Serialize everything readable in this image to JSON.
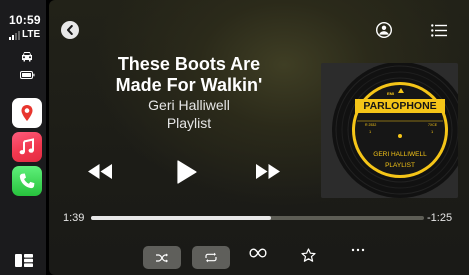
{
  "status_bar": {
    "time": "10:59",
    "network": "LTE"
  },
  "sidebar": {
    "apps": [
      {
        "name": "Maps",
        "icon": "maps-icon",
        "color": "#ffffff"
      },
      {
        "name": "Music",
        "icon": "music-note-icon",
        "color": "#f2384f"
      },
      {
        "name": "Phone",
        "icon": "phone-icon",
        "color": "#27c23d"
      }
    ]
  },
  "now_playing": {
    "title": "These Boots Are\nMade For Walkin'",
    "artist": "Geri Halliwell",
    "source": "Playlist",
    "elapsed": "1:39",
    "remaining": "-1:25",
    "progress": 0.54
  },
  "artwork": {
    "label_brand": "PARLOPHONE",
    "label_line1": "GERI HALLIWELL",
    "label_line2": "PLAYLIST",
    "label_color": "#f5c518"
  },
  "controls": {
    "shuffle_active": true,
    "repeat_active": true
  }
}
